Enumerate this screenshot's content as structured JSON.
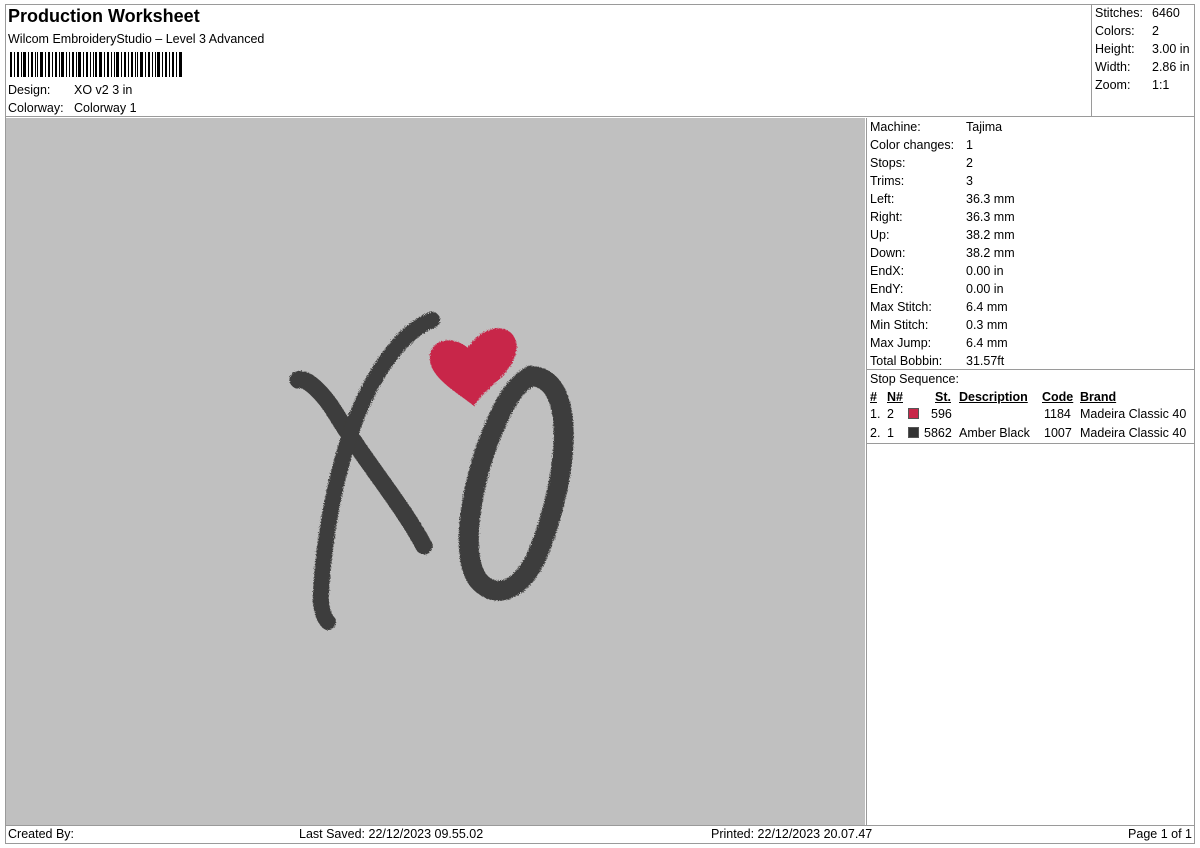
{
  "header": {
    "title": "Production Worksheet",
    "subtitle": "Wilcom EmbroideryStudio – Level 3 Advanced",
    "design_label": "Design:",
    "design_value": "XO v2 3 in",
    "colorway_label": "Colorway:",
    "colorway_value": "Colorway 1"
  },
  "stats": [
    {
      "label": "Stitches:",
      "value": "6460"
    },
    {
      "label": "Colors:",
      "value": "2"
    },
    {
      "label": "Height:",
      "value": "3.00 in"
    },
    {
      "label": "Width:",
      "value": "2.86 in"
    },
    {
      "label": "Zoom:",
      "value": "1:1"
    }
  ],
  "properties": [
    {
      "label": "Machine:",
      "value": "Tajima"
    },
    {
      "label": "Color changes:",
      "value": "1"
    },
    {
      "label": "Stops:",
      "value": "2"
    },
    {
      "label": "Trims:",
      "value": "3"
    },
    {
      "label": "Left:",
      "value": "36.3 mm"
    },
    {
      "label": "Right:",
      "value": "36.3 mm"
    },
    {
      "label": "Up:",
      "value": "38.2 mm"
    },
    {
      "label": "Down:",
      "value": "38.2 mm"
    },
    {
      "label": "EndX:",
      "value": "0.00 in"
    },
    {
      "label": "EndY:",
      "value": "0.00 in"
    },
    {
      "label": "Max Stitch:",
      "value": "6.4 mm"
    },
    {
      "label": "Min Stitch:",
      "value": "0.3 mm"
    },
    {
      "label": "Max Jump:",
      "value": "6.4 mm"
    },
    {
      "label": "Total Bobbin:",
      "value": "31.57ft"
    }
  ],
  "stop_sequence": {
    "title": "Stop Sequence:",
    "headers": {
      "idx": "#",
      "n": "N#",
      "st": "St.",
      "desc": "Description",
      "code": "Code",
      "brand": "Brand"
    },
    "rows": [
      {
        "idx": "1.",
        "n": "2",
        "color": "#c8284a",
        "st": "596",
        "desc": "",
        "code": "1184",
        "brand": "Madeira Classic 40"
      },
      {
        "idx": "2.",
        "n": "1",
        "color": "#333333",
        "st": "5862",
        "desc": "Amber Black",
        "code": "1007",
        "brand": "Madeira Classic 40"
      }
    ]
  },
  "design": {
    "background": "#c0c0c0",
    "thread_colors": [
      "#c8284a",
      "#3e3e3c"
    ]
  },
  "footer": {
    "created_by": "Created By:",
    "last_saved": "Last Saved: 22/12/2023 09.55.02",
    "printed": "Printed: 22/12/2023 20.07.47",
    "page": "Page 1 of 1"
  }
}
